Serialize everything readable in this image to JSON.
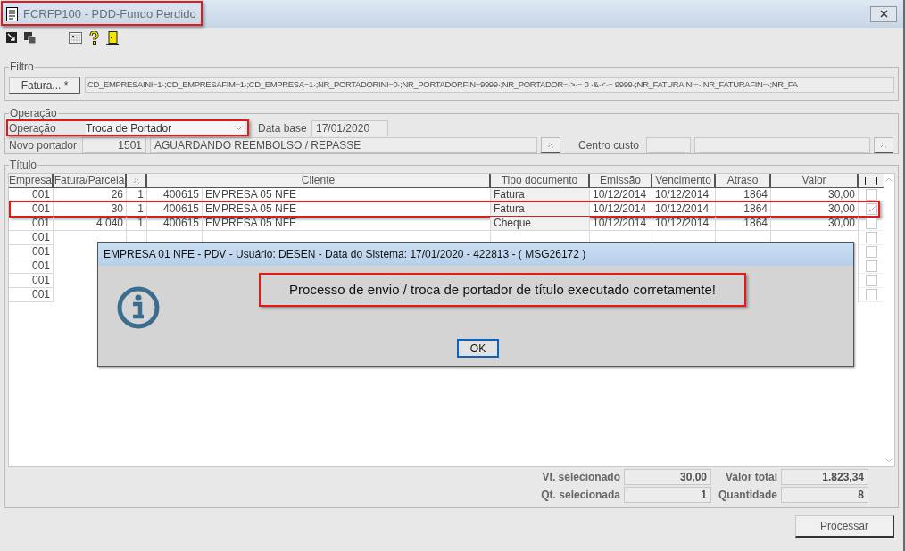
{
  "window": {
    "title": "FCRFP100 - PDD-Fundo Perdido",
    "highlighted": true
  },
  "filtro": {
    "legend": "Filtro",
    "button": "Fatura... *",
    "value": "CD_EMPRESAINI=1·;CD_EMPRESAFIM=1·;CD_EMPRESA=1·;NR_PORTADORINI=0·;NR_PORTADORFIN=9999·;NR_PORTADOR=·>·= 0 ·&·<·= 9999·;NR_FATURAINI=·;NR_FATURAFIN=·;NR_FA"
  },
  "operacao": {
    "legend": "Operação",
    "label": "Operação",
    "value": "Troca de Portador",
    "highlighted": true,
    "data_base_label": "Data base",
    "data_base": "17/01/2020",
    "novo_portador_label": "Novo portador",
    "novo_portador_code": "1501",
    "novo_portador_name": "AGUARDANDO REEMBOLSO / REPASSE",
    "centro_custo_label": "Centro custo"
  },
  "titulo": {
    "legend": "Título",
    "columns": [
      "Empresa",
      "Fatura/Parcela",
      "Cliente",
      "Tipo documento",
      "Emissão",
      "Vencimento",
      "Atraso",
      "Valor"
    ],
    "rows": [
      {
        "empresa": "001",
        "fatura": "26",
        "parcela": "1",
        "cliente_code": "400615",
        "cliente_name": "EMPRESA 05 NFE",
        "tipo": "Fatura",
        "emissao": "10/12/2014",
        "vencimento": "10/12/2014",
        "atraso": "1864",
        "valor": "30,00",
        "checked": false,
        "highlighted": false
      },
      {
        "empresa": "001",
        "fatura": "30",
        "parcela": "1",
        "cliente_code": "400615",
        "cliente_name": "EMPRESA 05 NFE",
        "tipo": "Fatura",
        "emissao": "10/12/2014",
        "vencimento": "10/12/2014",
        "atraso": "1864",
        "valor": "30,00",
        "checked": true,
        "highlighted": true
      },
      {
        "empresa": "001",
        "fatura": "4.040",
        "parcela": "1",
        "cliente_code": "400615",
        "cliente_name": "EMPRESA 05 NFE",
        "tipo": "Cheque",
        "emissao": "10/12/2014",
        "vencimento": "10/12/2014",
        "atraso": "1864",
        "valor": "30,00",
        "checked": false,
        "highlighted": false
      },
      {
        "empresa": "001",
        "checked": false,
        "highlighted": false
      },
      {
        "empresa": "001",
        "checked": false,
        "highlighted": false
      },
      {
        "empresa": "001",
        "checked": false,
        "highlighted": false
      },
      {
        "empresa": "001",
        "checked": false,
        "highlighted": false
      },
      {
        "empresa": "001",
        "checked": false,
        "highlighted": false
      }
    ],
    "totals": [
      {
        "label": "Vl. selecionado",
        "value": "30,00"
      },
      {
        "label": "Valor total",
        "value": "1.823,34"
      },
      {
        "label": "Qt. selecionada",
        "value": "1"
      },
      {
        "label": "Quantidade",
        "value": "8"
      }
    ]
  },
  "process_button": "Processar",
  "dialog": {
    "title": "EMPRESA 01 NFE - PDV - Usuário: DESEN - Data do Sistema: 17/01/2020 - 422813 - ( MSG26172 )",
    "message": "Processo de envio / troca de portador de título executado corretamente!",
    "highlighted": true,
    "button": "OK"
  }
}
